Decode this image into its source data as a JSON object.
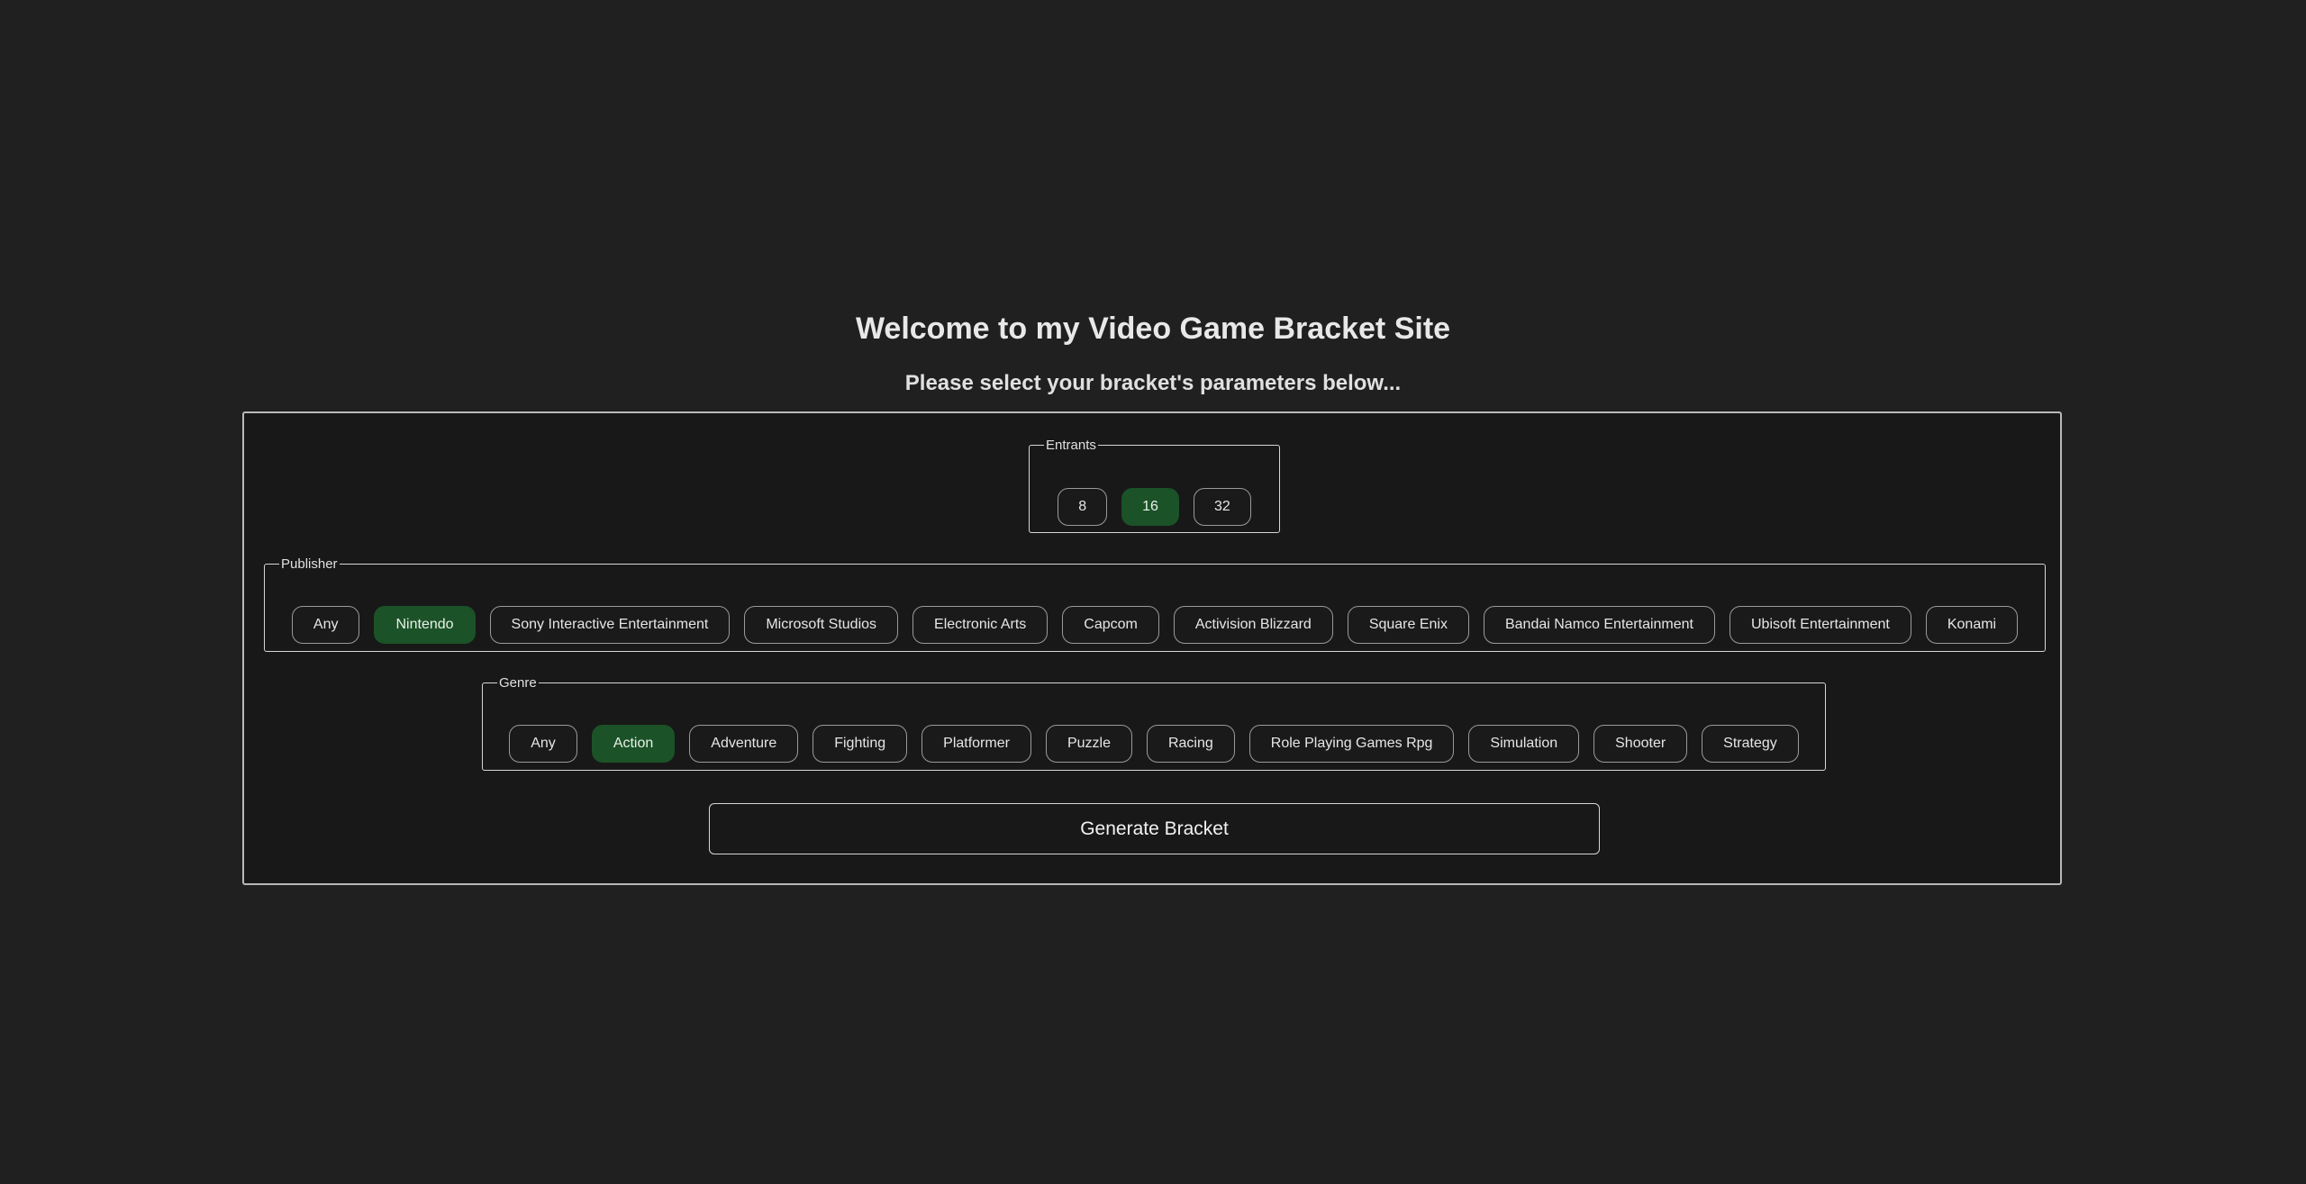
{
  "header": {
    "title": "Welcome to my Video Game Bracket Site",
    "subtitle": "Please select your bracket's parameters below..."
  },
  "entrants": {
    "legend": "Entrants",
    "options": [
      "8",
      "16",
      "32"
    ],
    "selected": "16"
  },
  "publisher": {
    "legend": "Publisher",
    "options": [
      "Any",
      "Nintendo",
      "Sony Interactive Entertainment",
      "Microsoft Studios",
      "Electronic Arts",
      "Capcom",
      "Activision Blizzard",
      "Square Enix",
      "Bandai Namco Entertainment",
      "Ubisoft Entertainment",
      "Konami"
    ],
    "selected": "Nintendo"
  },
  "genre": {
    "legend": "Genre",
    "options": [
      "Any",
      "Action",
      "Adventure",
      "Fighting",
      "Platformer",
      "Puzzle",
      "Racing",
      "Role Playing Games Rpg",
      "Simulation",
      "Shooter",
      "Strategy"
    ],
    "selected": "Action"
  },
  "actions": {
    "generate_label": "Generate Bracket"
  },
  "colors": {
    "background": "#202020",
    "panel": "#181818",
    "selected_option": "#1b5227"
  }
}
